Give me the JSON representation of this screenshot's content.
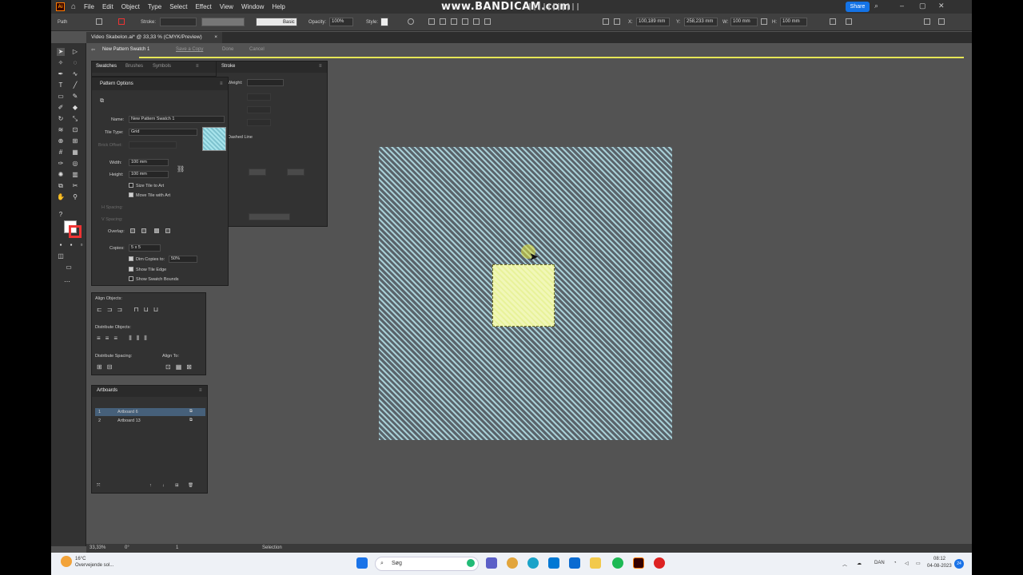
{
  "menu": {
    "app_logo": "Ai",
    "items": [
      "File",
      "Edit",
      "Object",
      "Type",
      "Select",
      "Effect",
      "View",
      "Window",
      "Help"
    ],
    "watermark": "www.BANDICAM.com",
    "share_label": "Share"
  },
  "control_bar": {
    "selection_type": "Path",
    "stroke_label": "Stroke:",
    "brush_label": "Basic",
    "opacity_label": "Opacity:",
    "opacity_value": "100%",
    "style_label": "Style:",
    "x_label": "X:",
    "x_value": "100,189 mm",
    "y_label": "Y:",
    "y_value": "258,233 mm",
    "w_label": "W:",
    "w_value": "100 mm",
    "h_label": "H:",
    "h_value": "100 mm"
  },
  "document_tab": {
    "title": "Video Skabelon.ai* @ 33,33 % (CMYK/Preview)",
    "close": "×"
  },
  "pattern_edit_bar": {
    "swatch_name": "New Pattern Swatch 1",
    "save_copy": "Save a Copy",
    "done": "Done",
    "cancel": "Cancel"
  },
  "swatches_panel": {
    "tabs": [
      "Swatches",
      "Brushes",
      "Symbols"
    ]
  },
  "stroke_panel": {
    "tab": "Stroke",
    "weight_label": "Weight:",
    "dashed_line_label": "Dashed Line"
  },
  "pattern_options": {
    "title": "Pattern Options",
    "name_label": "Name:",
    "name_value": "New Pattern Swatch 1",
    "tile_type_label": "Tile Type:",
    "tile_type_value": "Grid",
    "brick_offset_label": "Brick Offset:",
    "width_label": "Width:",
    "width_value": "100 mm",
    "height_label": "Height:",
    "height_value": "100 mm",
    "size_tile_to_art": "Size Tile to Art",
    "move_tile_with_art": "Move Tile with Art",
    "h_spacing_label": "H Spacing:",
    "v_spacing_label": "V Spacing:",
    "overlap_label": "Overlap:",
    "copies_label": "Copies:",
    "copies_value": "5 x 5",
    "dim_copies_label": "Dim Copies to:",
    "dim_copies_value": "50%",
    "show_tile_edge": "Show Tile Edge",
    "show_swatch_bounds": "Show Swatch Bounds",
    "size_tile_to_art_checked": false,
    "move_tile_with_art_checked": true,
    "dim_copies_checked": true,
    "show_tile_edge_checked": true,
    "show_swatch_bounds_checked": false,
    "swatch_preview_color": "#a8e4ec"
  },
  "align_panel": {
    "align_objects": "Align Objects:",
    "distribute_objects": "Distribute Objects:",
    "distribute_spacing": "Distribute Spacing:",
    "align_to": "Align To:"
  },
  "artboards_panel": {
    "title": "Artboards",
    "rows": [
      {
        "index": "1",
        "name": "Artboard 6",
        "selected": true
      },
      {
        "index": "2",
        "name": "Artboard 13",
        "selected": false
      }
    ]
  },
  "status_bar": {
    "zoom": "33,33%",
    "rotation": "0°",
    "artboard_number": "1",
    "tool": "Selection"
  },
  "taskbar": {
    "temperature": "16°C",
    "weather": "Overvejende sol...",
    "search_placeholder": "Søg",
    "language": "DAN",
    "time": "08:12",
    "date": "04-08-2023",
    "notification_count": "24"
  },
  "colors": {
    "ui_dark": "#323232",
    "canvas": "#535353",
    "pattern_stripe_light": "#a8cfd6",
    "pattern_stripe_dark": "#59636a",
    "tile_fill": "#eef5a8",
    "edit_mode_line": "#e6e657",
    "share_blue": "#1473e6"
  }
}
